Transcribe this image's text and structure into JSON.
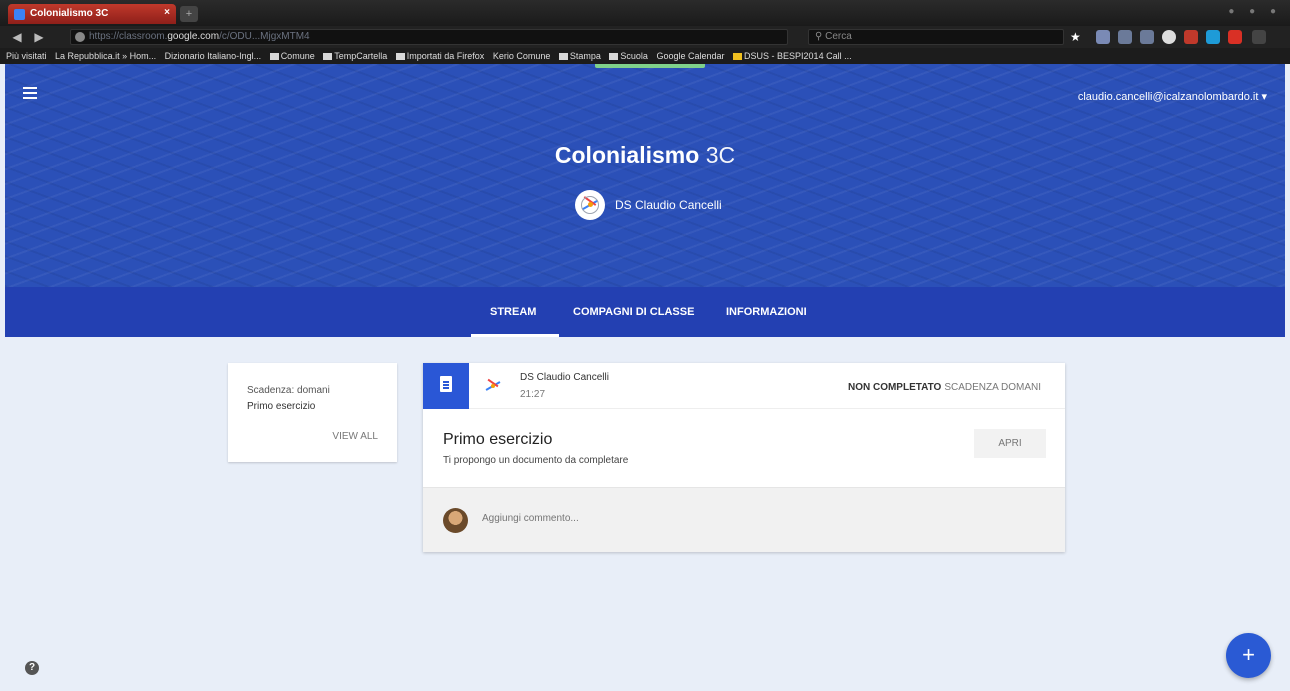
{
  "browser": {
    "tab_title": "Colonialismo 3C",
    "tab_close": "×",
    "url_prefix": "https://classroom.",
    "url_domain": "google.com",
    "url_path": "/c/ODU...MjgxMTM4",
    "search_placeholder": "Cerca",
    "bookmarks": [
      "Più visitati",
      "La Repubblica.it » Hom...",
      "Dizionario Italiano-Ingl...",
      "Comune",
      "TempCartella",
      "Importati da Firefox",
      "Kerio Comune",
      "Stampa",
      "Scuola",
      "Google Calendar",
      "DSUS - BESPI2014 Call ..."
    ]
  },
  "header": {
    "account": "claudio.cancelli@icalzanolombardo.it",
    "account_caret": "▾",
    "class_name": "Colonialismo",
    "class_section": "3C",
    "teacher": "DS Claudio Cancelli"
  },
  "tabs": {
    "stream": "STREAM",
    "classmates": "COMPAGNI DI CLASSE",
    "about": "INFORMAZIONI"
  },
  "upcoming": {
    "due": "Scadenza: domani",
    "item": "Primo esercizio",
    "view_all": "VIEW ALL"
  },
  "post": {
    "author": "DS Claudio Cancelli",
    "time": "21:27",
    "status": "NON COMPLETATO",
    "due": "SCADENZA DOMANI",
    "title": "Primo esercizio",
    "description": "Ti propongo un documento da completare",
    "open_button": "APRI",
    "comment_placeholder": "Aggiungi commento..."
  },
  "misc": {
    "help": "?",
    "fab": "+"
  },
  "colors": {
    "hero": "#2b50b8",
    "tabsbar": "#2340b2",
    "accent": "#2a57d6",
    "background": "#e8eef8"
  }
}
